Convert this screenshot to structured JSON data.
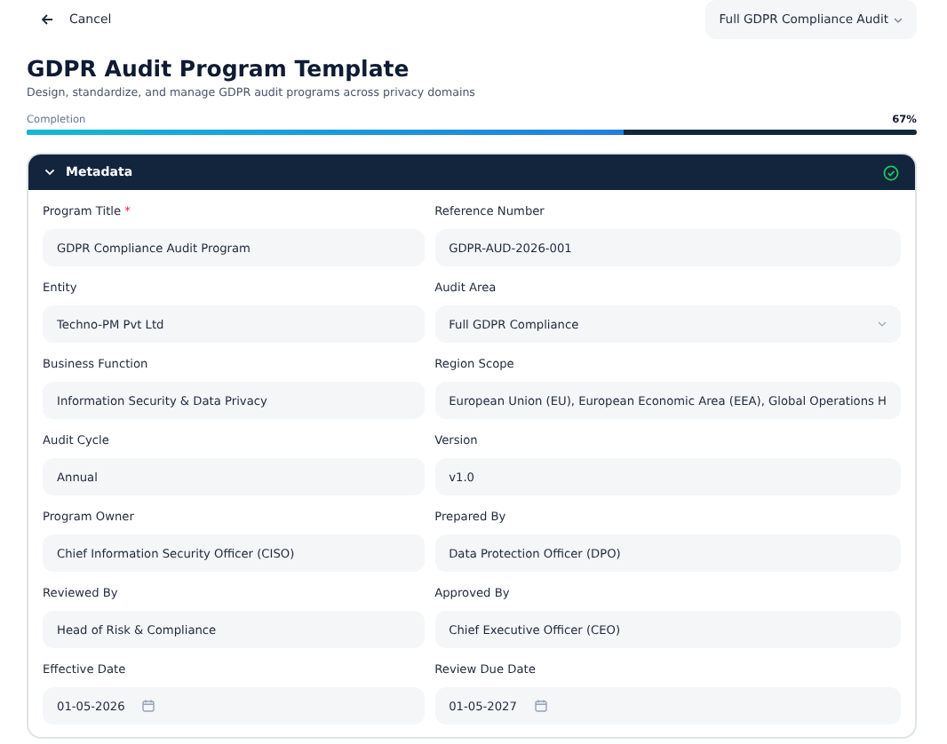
{
  "topbar": {
    "back_label": "Cancel",
    "template_select": "Full GDPR Compliance Audit"
  },
  "header": {
    "title": "GDPR Audit Program Template",
    "subtitle": "Design, standardize, and manage GDPR audit programs across privacy domains"
  },
  "progress": {
    "label": "Completion",
    "reading": "67%",
    "level": 0.67
  },
  "section": {
    "title": "Metadata",
    "expanded": true,
    "complete": true,
    "fields": [
      {
        "label": "Program Title",
        "required_mark": "*",
        "kind": "text",
        "value": "GDPR Compliance Audit Program"
      },
      {
        "label": "Reference Number",
        "kind": "text",
        "value": "GDPR-AUD-2026-001"
      },
      {
        "label": "Entity",
        "kind": "text",
        "value": "Techno-PM Pvt Ltd"
      },
      {
        "label": "Audit Area",
        "kind": "select",
        "value": "Full GDPR Compliance"
      },
      {
        "label": "Business Function",
        "kind": "text",
        "value": "Information Security & Data Privacy"
      },
      {
        "label": "Region Scope",
        "kind": "text",
        "value": "European Union (EU), European Economic Area (EEA), Global Operations H"
      },
      {
        "label": "Audit Cycle",
        "kind": "text",
        "value": "Annual"
      },
      {
        "label": "Version",
        "kind": "text",
        "value": "v1.0"
      },
      {
        "label": "Program Owner",
        "kind": "text",
        "value": "Chief Information Security Officer (CISO)"
      },
      {
        "label": "Prepared By",
        "kind": "text",
        "value": "Data Protection Officer (DPO)"
      },
      {
        "label": "Reviewed By",
        "kind": "text",
        "value": "Head of Risk & Compliance"
      },
      {
        "label": "Approved By",
        "kind": "text",
        "value": "Chief Executive Officer (CEO)"
      },
      {
        "label": "Effective Date",
        "kind": "date",
        "value": "01-05-2026"
      },
      {
        "label": "Review Due Date",
        "kind": "date",
        "value": "01-05-2027"
      }
    ]
  }
}
